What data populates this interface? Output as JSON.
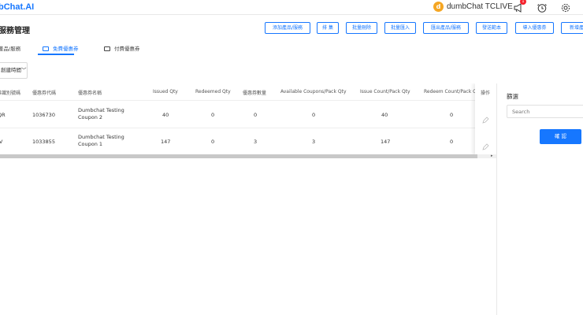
{
  "header": {
    "logo": "bChat.AI",
    "user_initial": "d",
    "user_name": "dumbChat TCLIVE",
    "notification_count": "1"
  },
  "page": {
    "title": "服務管理",
    "actions": [
      "添加產品/服務",
      "排 集",
      "批量刪除",
      "批量匯入",
      "匯出產品/服務",
      "發送範本",
      "導入優惠券",
      "新增產"
    ]
  },
  "tabs": [
    {
      "label": "產品/服務"
    },
    {
      "label": "免費優惠券"
    },
    {
      "label": "付費優惠券"
    }
  ],
  "sort": {
    "label": "創建時間"
  },
  "table": {
    "columns": [
      "券識別號碼",
      "優惠券代碼",
      "優惠券名稱",
      "Issued Qty",
      "Redeemed Qty",
      "優惠券數量",
      "Available Coupons/Pack Qty",
      "Issue Count/Pack Qty",
      "Redeem Count/Pack Qty",
      "操作"
    ],
    "rows": [
      {
        "id": "QR",
        "code": "1036730",
        "name": "Dumbchat Testing Coupon 2",
        "issued": "40",
        "redeemed": "0",
        "qty": "0",
        "available": "0",
        "issue_count": "40",
        "redeem_count": "0"
      },
      {
        "id": "JV",
        "code": "1033855",
        "name": "Dumbchat Testing Coupon 1",
        "issued": "147",
        "redeemed": "0",
        "qty": "3",
        "available": "3",
        "issue_count": "147",
        "redeem_count": "0"
      }
    ]
  },
  "filter": {
    "title": "篩選",
    "search_placeholder": "Search",
    "button": "確 認"
  },
  "colors": {
    "accent": "#1677ff",
    "avatar": "#f5a623",
    "badge": "#f5222d"
  }
}
